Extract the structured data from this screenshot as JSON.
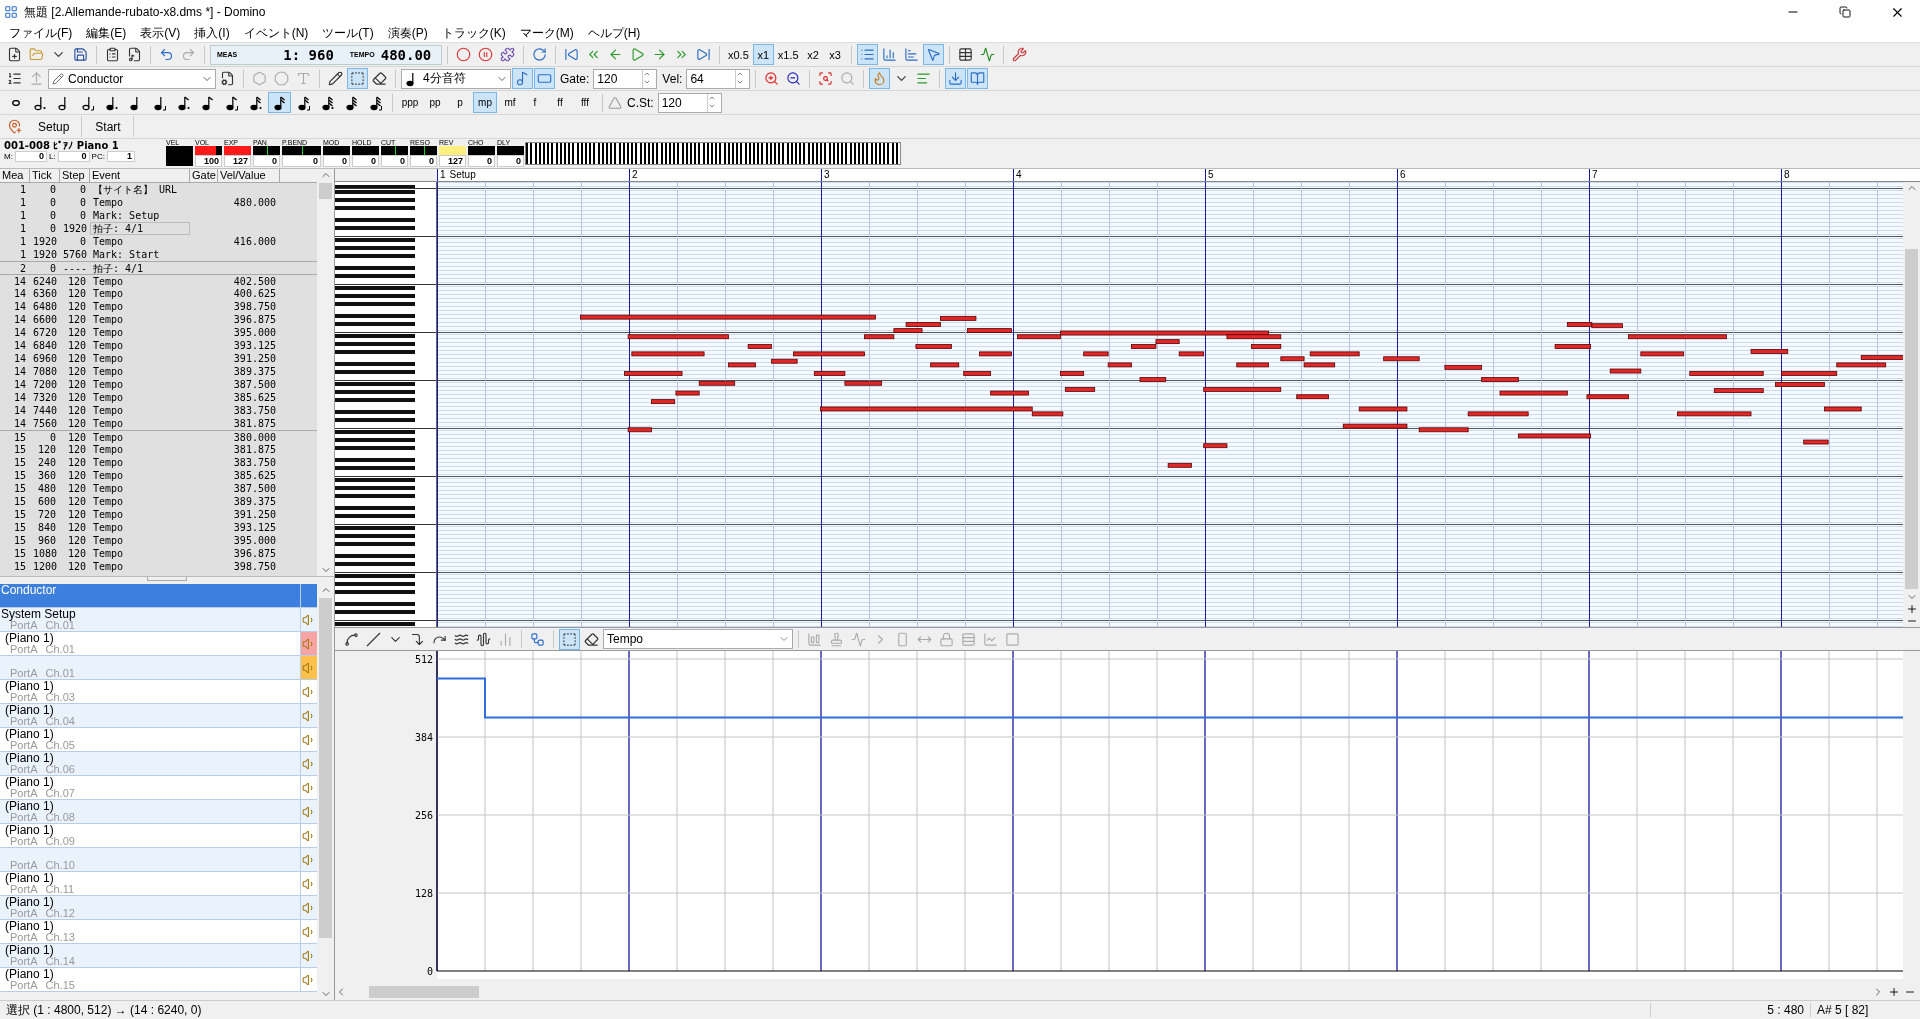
{
  "window": {
    "title": "無題 [2.Allemande-rubato-x8.dms *] - Domino"
  },
  "menu": [
    "ファイル(F)",
    "編集(E)",
    "表示(V)",
    "挿入(I)",
    "イベント(N)",
    "ツール(T)",
    "演奏(P)",
    "トラック(K)",
    "マーク(M)",
    "ヘルプ(H)"
  ],
  "transport": {
    "meas_label": "MEAS",
    "position": "1: 960",
    "tempo_label": "TEMPO",
    "tempo": "480.00"
  },
  "speeds": [
    {
      "label": "x0.5",
      "selected": false
    },
    {
      "label": "x1",
      "selected": true
    },
    {
      "label": "x1.5",
      "selected": false
    },
    {
      "label": "x2",
      "selected": false
    },
    {
      "label": "x3",
      "selected": false
    }
  ],
  "view_toggles": [
    {
      "on": true
    },
    {
      "on": false
    },
    {
      "on": false
    },
    {
      "on": true
    }
  ],
  "track_select": {
    "value": "Conductor"
  },
  "edit_tools": [
    {
      "on": false
    },
    {
      "on": true
    },
    {
      "on": false
    }
  ],
  "note_length": {
    "value": "4分音符"
  },
  "note_toggles": [
    {
      "on": true
    },
    {
      "on": true
    }
  ],
  "gate": {
    "label": "Gate:",
    "value": "120"
  },
  "velocity": {
    "label": "Vel:",
    "value": "64"
  },
  "note_buttons": [
    {
      "selected": false
    },
    {
      "selected": false
    },
    {
      "selected": false
    },
    {
      "selected": false
    },
    {
      "selected": false
    },
    {
      "selected": false
    },
    {
      "selected": false
    },
    {
      "selected": false
    },
    {
      "selected": false
    },
    {
      "selected": false
    },
    {
      "selected": false
    },
    {
      "selected": true
    },
    {
      "selected": false
    },
    {
      "selected": false
    },
    {
      "selected": false
    },
    {
      "selected": false
    }
  ],
  "dynamics": [
    {
      "label": "ppp",
      "selected": false
    },
    {
      "label": "pp",
      "selected": false
    },
    {
      "label": "p",
      "selected": false
    },
    {
      "label": "mp",
      "selected": true
    },
    {
      "label": "mf",
      "selected": false
    },
    {
      "label": "f",
      "selected": false
    },
    {
      "label": "ff",
      "selected": false
    },
    {
      "label": "fff",
      "selected": false
    }
  ],
  "c_st": {
    "label": "C.St:",
    "value": "120"
  },
  "markers": [
    "Setup",
    "Start"
  ],
  "track_info": {
    "name": "001-008 ﾋﾟｱﾉ Piano 1",
    "m_label": "M:",
    "m": "0",
    "l_label": "L:",
    "l": "0",
    "pc_label": "PC:",
    "pc": "1"
  },
  "controllers": [
    {
      "label": "VEL",
      "kind": "box"
    },
    {
      "label": "VOL",
      "kind": "bar",
      "value": "100",
      "level": 0.79,
      "color": "#ff1a1a"
    },
    {
      "label": "EXP",
      "kind": "bar",
      "value": "127",
      "level": 1,
      "color": "#ff1a1a"
    },
    {
      "label": "PAN",
      "kind": "center",
      "value": "0"
    },
    {
      "label": "P.BEND",
      "kind": "center",
      "value": "0"
    },
    {
      "label": "MOD",
      "kind": "bar",
      "value": "0"
    },
    {
      "label": "HOLD",
      "kind": "bar",
      "value": "0"
    },
    {
      "label": "CUT",
      "kind": "center",
      "value": "0"
    },
    {
      "label": "RESO",
      "kind": "center",
      "value": "0"
    },
    {
      "label": "REV",
      "kind": "bar",
      "value": "127",
      "level": 1,
      "color": "#ffef80"
    },
    {
      "label": "CHO",
      "kind": "bar",
      "value": "0"
    },
    {
      "label": "DLY",
      "kind": "bar",
      "value": "0"
    }
  ],
  "event_list": {
    "columns": [
      "Mea",
      "Tick",
      "Step",
      "Event",
      "Gate",
      "Vel/Value"
    ],
    "rows": [
      {
        "mea": "1",
        "tick": "0",
        "step": "0",
        "event": "【サイト名】 URL",
        "focused": false
      },
      {
        "mea": "1",
        "tick": "0",
        "step": "0",
        "event": "Tempo",
        "value": "480.000",
        "focused": false
      },
      {
        "mea": "1",
        "tick": "0",
        "step": "0",
        "event": "Mark: Setup",
        "focused": false
      },
      {
        "mea": "1",
        "tick": "0",
        "step": "1920",
        "event": "拍子: 4/1",
        "focused": true
      },
      {
        "mea": "1",
        "tick": "1920",
        "step": "0",
        "event": "Tempo",
        "value": "416.000",
        "focused": false
      },
      {
        "mea": "1",
        "tick": "1920",
        "step": "5760",
        "event": "Mark: Start",
        "focused": false
      },
      {
        "mea": "2",
        "tick": "0",
        "step": "----",
        "event": "拍子: 4/1",
        "focused": false
      },
      {
        "mea": "14",
        "tick": "6240",
        "step": "120",
        "event": "Tempo",
        "value": "402.500",
        "focused": false
      },
      {
        "mea": "14",
        "tick": "6360",
        "step": "120",
        "event": "Tempo",
        "value": "400.625",
        "focused": false
      },
      {
        "mea": "14",
        "tick": "6480",
        "step": "120",
        "event": "Tempo",
        "value": "398.750",
        "focused": false
      },
      {
        "mea": "14",
        "tick": "6600",
        "step": "120",
        "event": "Tempo",
        "value": "396.875",
        "focused": false
      },
      {
        "mea": "14",
        "tick": "6720",
        "step": "120",
        "event": "Tempo",
        "value": "395.000",
        "focused": false
      },
      {
        "mea": "14",
        "tick": "6840",
        "step": "120",
        "event": "Tempo",
        "value": "393.125",
        "focused": false
      },
      {
        "mea": "14",
        "tick": "6960",
        "step": "120",
        "event": "Tempo",
        "value": "391.250",
        "focused": false
      },
      {
        "mea": "14",
        "tick": "7080",
        "step": "120",
        "event": "Tempo",
        "value": "389.375",
        "focused": false
      },
      {
        "mea": "14",
        "tick": "7200",
        "step": "120",
        "event": "Tempo",
        "value": "387.500",
        "focused": false
      },
      {
        "mea": "14",
        "tick": "7320",
        "step": "120",
        "event": "Tempo",
        "value": "385.625",
        "focused": false
      },
      {
        "mea": "14",
        "tick": "7440",
        "step": "120",
        "event": "Tempo",
        "value": "383.750",
        "focused": false
      },
      {
        "mea": "14",
        "tick": "7560",
        "step": "120",
        "event": "Tempo",
        "value": "381.875",
        "focused": false
      },
      {
        "mea": "15",
        "tick": "0",
        "step": "120",
        "event": "Tempo",
        "value": "380.000",
        "focused": false
      },
      {
        "mea": "15",
        "tick": "120",
        "step": "120",
        "event": "Tempo",
        "value": "381.875",
        "focused": false
      },
      {
        "mea": "15",
        "tick": "240",
        "step": "120",
        "event": "Tempo",
        "value": "383.750",
        "focused": false
      },
      {
        "mea": "15",
        "tick": "360",
        "step": "120",
        "event": "Tempo",
        "value": "385.625",
        "focused": false
      },
      {
        "mea": "15",
        "tick": "480",
        "step": "120",
        "event": "Tempo",
        "value": "387.500",
        "focused": false
      },
      {
        "mea": "15",
        "tick": "600",
        "step": "120",
        "event": "Tempo",
        "value": "389.375",
        "focused": false
      },
      {
        "mea": "15",
        "tick": "720",
        "step": "120",
        "event": "Tempo",
        "value": "391.250",
        "focused": false
      },
      {
        "mea": "15",
        "tick": "840",
        "step": "120",
        "event": "Tempo",
        "value": "393.125",
        "focused": false
      },
      {
        "mea": "15",
        "tick": "960",
        "step": "120",
        "event": "Tempo",
        "value": "395.000",
        "focused": false
      },
      {
        "mea": "15",
        "tick": "1080",
        "step": "120",
        "event": "Tempo",
        "value": "396.875",
        "focused": false
      },
      {
        "mea": "15",
        "tick": "1200",
        "step": "120",
        "event": "Tempo",
        "value": "398.750",
        "focused": false
      }
    ]
  },
  "tracks": [
    {
      "name": "Conductor",
      "selected": true
    },
    {
      "name": "System Setup",
      "port": "PortA",
      "channel": "Ch.01",
      "selected": false
    },
    {
      "name": "(Piano 1)",
      "port": "PortA",
      "channel": "Ch.01",
      "selected": false,
      "color": "#f7a4a4"
    },
    {
      "port": "PortA",
      "channel": "Ch.01",
      "selected": false,
      "color": "#ffc04c"
    },
    {
      "name": "(Piano 1)",
      "port": "PortA",
      "channel": "Ch.03",
      "selected": false
    },
    {
      "name": "(Piano 1)",
      "port": "PortA",
      "channel": "Ch.04",
      "selected": false
    },
    {
      "name": "(Piano 1)",
      "port": "PortA",
      "channel": "Ch.05",
      "selected": false
    },
    {
      "name": "(Piano 1)",
      "port": "PortA",
      "channel": "Ch.06",
      "selected": false
    },
    {
      "name": "(Piano 1)",
      "port": "PortA",
      "channel": "Ch.07",
      "selected": false
    },
    {
      "name": "(Piano 1)",
      "port": "PortA",
      "channel": "Ch.08",
      "selected": false
    },
    {
      "name": "(Piano 1)",
      "port": "PortA",
      "channel": "Ch.09",
      "selected": false
    },
    {
      "port": "PortA",
      "channel": "Ch.10",
      "selected": false
    },
    {
      "name": "(Piano 1)",
      "port": "PortA",
      "channel": "Ch.11",
      "selected": false
    },
    {
      "name": "(Piano 1)",
      "port": "PortA",
      "channel": "Ch.12",
      "selected": false
    },
    {
      "name": "(Piano 1)",
      "port": "PortA",
      "channel": "Ch.13",
      "selected": false
    },
    {
      "name": "(Piano 1)",
      "port": "PortA",
      "channel": "Ch.14",
      "selected": false
    },
    {
      "name": "(Piano 1)",
      "port": "PortA",
      "channel": "Ch.15",
      "selected": false
    }
  ],
  "ruler": [
    {
      "label": "1",
      "marker": "Setup"
    },
    {
      "label": "2"
    },
    {
      "label": "3"
    },
    {
      "label": "4"
    },
    {
      "label": "5"
    },
    {
      "label": "6"
    },
    {
      "label": "7"
    },
    {
      "label": "8"
    }
  ],
  "control_editor": {
    "type": "Tempo",
    "axis_labels": [
      "512",
      "384",
      "256",
      "128",
      "0"
    ]
  },
  "status": {
    "selection": "選択 (1 : 4800, 512) → (14 : 6240, 0)",
    "position": "5 : 480",
    "pitch": "A# 5 [ 82]"
  }
}
